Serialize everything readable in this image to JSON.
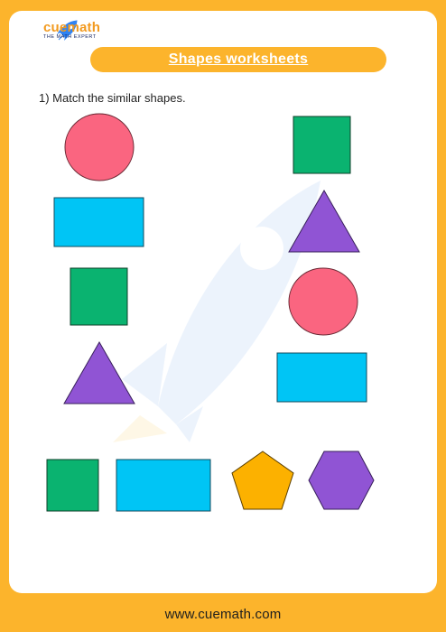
{
  "brand": {
    "name": "cuemath",
    "tagline": "THE MATH EXPERT"
  },
  "title": "Shapes worksheets",
  "question": "1) Match the similar shapes.",
  "footer": "www.cuemath.com",
  "colors": {
    "frame": "#fcb42c",
    "circle": "#fa6580",
    "rectangle": "#00c5f5",
    "square": "#0ab370",
    "triangle": "#9054d4",
    "pentagon": "#fcb100",
    "hexagon": "#9054d4"
  },
  "left_column": [
    "circle",
    "rectangle",
    "square",
    "triangle"
  ],
  "right_column": [
    "square",
    "triangle",
    "circle",
    "rectangle"
  ],
  "bottom_row": [
    "square",
    "rectangle",
    "pentagon",
    "hexagon"
  ]
}
